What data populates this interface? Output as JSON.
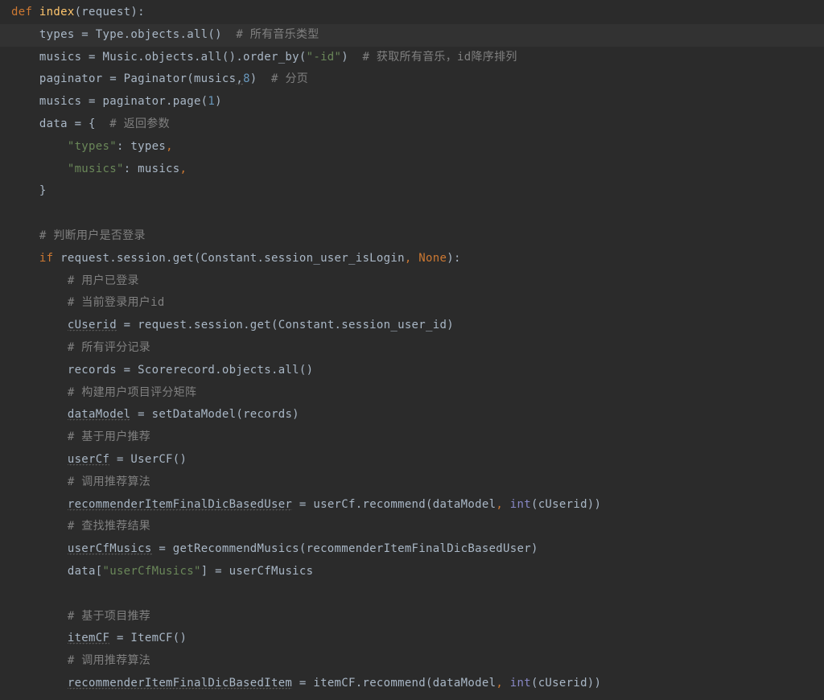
{
  "code": {
    "l1": {
      "kw1": "def ",
      "fn": "index",
      "p1": "(request)",
      "p2": ":"
    },
    "l2": {
      "ind": "    ",
      "t1": "types = Type.objects.all()  ",
      "c1": "# 所有音乐类型"
    },
    "l3": {
      "ind": "    ",
      "t1": "musics = Music.objects.all().order_by(",
      "s1": "\"-id\"",
      "t2": ")  ",
      "c1": "# 获取所有音乐，id降序排列"
    },
    "l4": {
      "ind": "    ",
      "t1": "paginator = Paginator(musics",
      "comma": ",",
      "n1": "8",
      "t2": ")  ",
      "c1": "# 分页"
    },
    "l5": {
      "ind": "    ",
      "t1": "musics = paginator.page(",
      "n1": "1",
      "t2": ")"
    },
    "l6": {
      "ind": "    ",
      "t1": "data = {  ",
      "c1": "# 返回参数"
    },
    "l7": {
      "ind": "        ",
      "s1": "\"types\"",
      "t1": ": types",
      "comma": ","
    },
    "l8": {
      "ind": "        ",
      "s1": "\"musics\"",
      "t1": ": musics",
      "comma": ","
    },
    "l9": {
      "ind": "    ",
      "t1": "}"
    },
    "l10": "",
    "l11": {
      "ind": "    ",
      "c1": "# 判断用户是否登录"
    },
    "l12": {
      "ind": "    ",
      "kw1": "if ",
      "t1": "request.session.get(Constant.session_user_isLogin",
      "comma": ", ",
      "bn": "None",
      "t2": "):"
    },
    "l13": {
      "ind": "        ",
      "c1": "# 用户已登录"
    },
    "l14": {
      "ind": "        ",
      "c1": "# 当前登录用户id"
    },
    "l15": {
      "ind": "        ",
      "v1": "cUserid",
      "t1": " = request.session.get(Constant.session_user_id)"
    },
    "l16": {
      "ind": "        ",
      "c1": "# 所有评分记录"
    },
    "l17": {
      "ind": "        ",
      "t1": "records = Scorerecord.objects.all()"
    },
    "l18": {
      "ind": "        ",
      "c1": "# 构建用户项目评分矩阵"
    },
    "l19": {
      "ind": "        ",
      "v1": "dataModel",
      "t1": " = setDataModel(records)"
    },
    "l20": {
      "ind": "        ",
      "c1": "# 基于用户推荐"
    },
    "l21": {
      "ind": "        ",
      "v1": "userCf",
      "t1": " = UserCF()"
    },
    "l22": {
      "ind": "        ",
      "c1": "# 调用推荐算法"
    },
    "l23": {
      "ind": "        ",
      "v1": "recommenderItemFinalDicBasedUser",
      "t1": " = userCf.recommend(dataModel",
      "comma": ", ",
      "bi": "int",
      "t2": "(cUserid))"
    },
    "l24": {
      "ind": "        ",
      "c1": "# 查找推荐结果"
    },
    "l25": {
      "ind": "        ",
      "v1": "userCfMusics",
      "t1": " = getRecommendMusics(recommenderItemFinalDicBasedUser)"
    },
    "l26": {
      "ind": "        ",
      "t1": "data[",
      "s1": "\"userCfMusics\"",
      "t2": "] = userCfMusics"
    },
    "l27": "",
    "l28": {
      "ind": "        ",
      "c1": "# 基于项目推荐"
    },
    "l29": {
      "ind": "        ",
      "v1": "itemCF",
      "t1": " = ItemCF()"
    },
    "l30": {
      "ind": "        ",
      "c1": "# 调用推荐算法"
    },
    "l31": {
      "ind": "        ",
      "v1": "recommenderItemFinalDicBasedItem",
      "t1": " = itemCF.recommend(dataModel",
      "comma": ", ",
      "bi": "int",
      "t2": "(cUserid))"
    }
  }
}
